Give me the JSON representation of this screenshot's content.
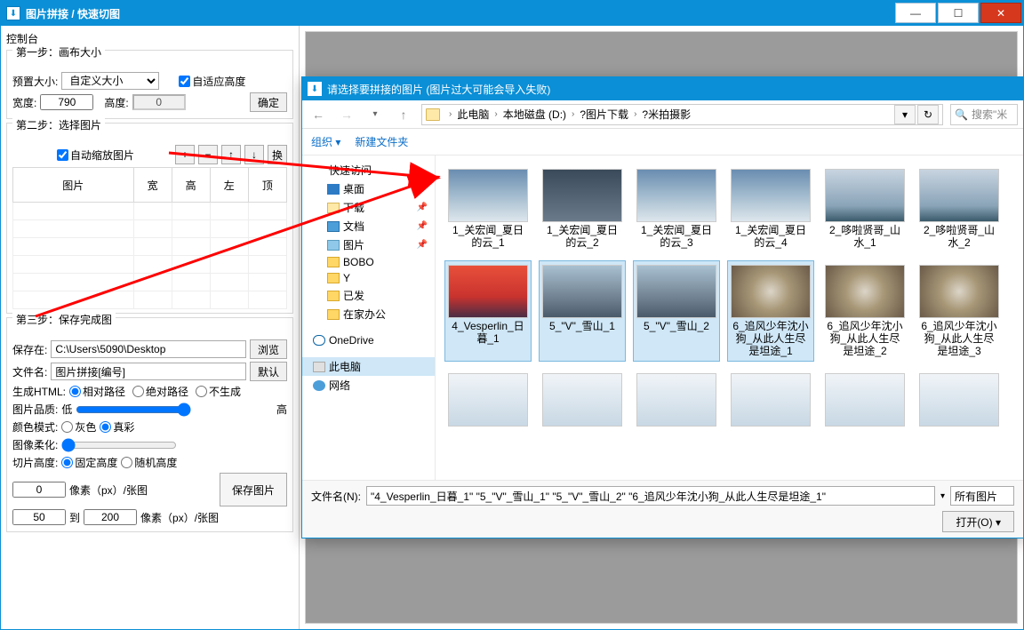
{
  "window": {
    "title": "图片拼接 / 快速切图",
    "min": "—",
    "max": "☐",
    "close": "✕"
  },
  "sidebar": {
    "console_label": "控制台",
    "step1": {
      "legend": "第一步：画布大小",
      "preset_label": "预置大小:",
      "preset_value": "自定义大小",
      "auto_height": "自适应高度",
      "width_label": "宽度:",
      "width_value": "790",
      "height_label": "高度:",
      "height_value": "0",
      "confirm": "确定"
    },
    "step2": {
      "legend": "第二步：选择图片",
      "auto_scale": "自动缩放图片",
      "add": "+",
      "remove": "−",
      "up": "↑",
      "down": "↓",
      "swap": "换",
      "headers": {
        "pic": "图片",
        "w": "宽",
        "h": "高",
        "l": "左",
        "t": "顶"
      }
    },
    "step3": {
      "legend": "第三步：保存完成图",
      "save_at": "保存在:",
      "save_path": "C:\\Users\\5090\\Desktop",
      "browse": "浏览",
      "filename_label": "文件名:",
      "filename_value": "图片拼接[编号]",
      "default_btn": "默认",
      "gen_html_label": "生成HTML:",
      "rel_path": "相对路径",
      "abs_path": "绝对路径",
      "no_gen": "不生成",
      "img_quality": "图片品质:",
      "low": "低",
      "high": "高",
      "color_mode": "颜色模式:",
      "gray": "灰色",
      "true_color": "真彩",
      "blur": "图像柔化:",
      "cut_height": "切片高度:",
      "fixed": "固定高度",
      "random": "随机高度",
      "px_per": "像素（px）/张图",
      "to": "到",
      "val0": "0",
      "val50": "50",
      "val200": "200",
      "save_btn": "保存图片"
    }
  },
  "dialog": {
    "title": "请选择要拼接的图片 (图片过大可能会导入失败)",
    "nav": {
      "back": "←",
      "fwd": "→",
      "up": "↑"
    },
    "crumbs": [
      "此电脑",
      "本地磁盘 (D:)",
      "?图片下载",
      "?米拍摄影"
    ],
    "refresh": "↻",
    "search_placeholder": "搜索\"米",
    "organize": "组织",
    "new_folder": "新建文件夹",
    "tree": [
      {
        "t": "快速访问",
        "cls": "star",
        "ind": 0
      },
      {
        "t": "桌面",
        "cls": "desktop",
        "ind": 1,
        "pin": true
      },
      {
        "t": "下载",
        "cls": "folder",
        "ind": 1,
        "pin": true
      },
      {
        "t": "文档",
        "cls": "doc",
        "ind": 1,
        "pin": true
      },
      {
        "t": "图片",
        "cls": "pics",
        "ind": 1,
        "pin": true
      },
      {
        "t": "BOBO",
        "cls": "folder-y",
        "ind": 1
      },
      {
        "t": "Y",
        "cls": "folder-y",
        "ind": 1
      },
      {
        "t": "已发",
        "cls": "folder-y",
        "ind": 1
      },
      {
        "t": "在家办公",
        "cls": "folder-y",
        "ind": 1
      },
      {
        "t": "OneDrive",
        "cls": "cloud",
        "ind": 0
      },
      {
        "t": "此电脑",
        "cls": "disk",
        "ind": 0,
        "sel": true
      },
      {
        "t": "网络",
        "cls": "net",
        "ind": 0
      }
    ],
    "thumbs": [
      {
        "cap": "1_关宏闻_夏日的云_1",
        "cls": "sky"
      },
      {
        "cap": "1_关宏闻_夏日的云_2",
        "cls": "dark"
      },
      {
        "cap": "1_关宏闻_夏日的云_3",
        "cls": "sky"
      },
      {
        "cap": "1_关宏闻_夏日的云_4",
        "cls": "sky"
      },
      {
        "cap": "2_哆啦贤哥_山水_1",
        "cls": "mount"
      },
      {
        "cap": "2_哆啦贤哥_山水_2",
        "cls": "mount"
      },
      {
        "cap": "4_Vesperlin_日暮_1",
        "cls": "sunset",
        "sel": true
      },
      {
        "cap": "5_\"V\"_雪山_1",
        "cls": "city",
        "sel": true
      },
      {
        "cap": "5_\"V\"_雪山_2",
        "cls": "city",
        "sel": true
      },
      {
        "cap": "6_追风少年沈小狗_从此人生尽是坦途_1",
        "cls": "swirl",
        "sel": true
      },
      {
        "cap": "6_追风少年沈小狗_从此人生尽是坦途_2",
        "cls": "swirl"
      },
      {
        "cap": "6_追风少年沈小狗_从此人生尽是坦途_3",
        "cls": "swirl"
      },
      {
        "cap": "",
        "cls": "arch"
      },
      {
        "cap": "",
        "cls": "arch"
      },
      {
        "cap": "",
        "cls": "arch"
      },
      {
        "cap": "",
        "cls": "arch"
      },
      {
        "cap": "",
        "cls": "arch"
      },
      {
        "cap": "",
        "cls": "arch"
      }
    ],
    "fname_label": "文件名(N):",
    "fname_value": "\"4_Vesperlin_日暮_1\" \"5_\"V\"_雪山_1\" \"5_\"V\"_雪山_2\" \"6_追风少年沈小狗_从此人生尽是坦途_1\"",
    "ftype": "所有图片",
    "open": "打开(O)"
  }
}
